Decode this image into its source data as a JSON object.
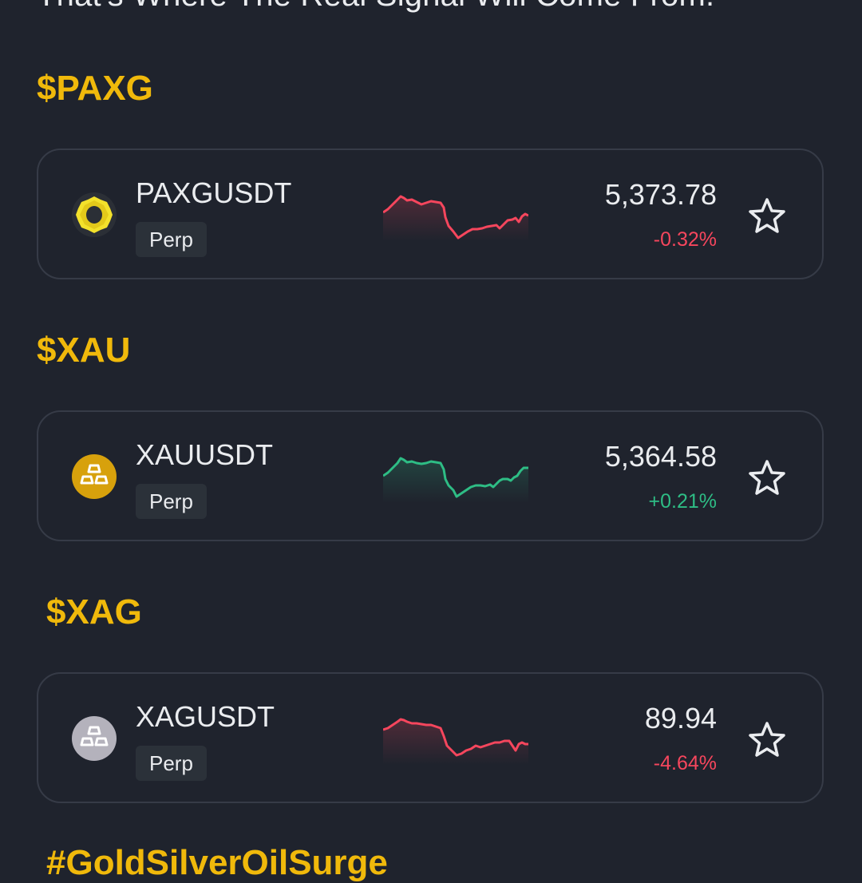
{
  "header": {
    "text": "That's Where The Real Signal Will Come From."
  },
  "sections": [
    {
      "title": "$PAXG",
      "card": {
        "icon": "paxg-coin-icon",
        "symbol": "PAXGUSDT",
        "badge": "Perp",
        "price": "5,373.78",
        "change": "-0.32%",
        "direction": "down",
        "sparkline_color": "#f6465d"
      }
    },
    {
      "title": "$XAU",
      "card": {
        "icon": "gold-bars-icon",
        "symbol": "XAUUSDT",
        "badge": "Perp",
        "price": "5,364.58",
        "change": "+0.21%",
        "direction": "up",
        "sparkline_color": "#2ebd85"
      }
    },
    {
      "title": "$XAG",
      "card": {
        "icon": "silver-bars-icon",
        "symbol": "XAGUSDT",
        "badge": "Perp",
        "price": "89.94",
        "change": "-4.64%",
        "direction": "down",
        "sparkline_color": "#f6465d"
      }
    }
  ],
  "footer": {
    "text": "#GoldSilverOilSurge"
  },
  "colors": {
    "background": "#1f232d",
    "accent": "#f0b90b",
    "up": "#2ebd85",
    "down": "#f6465d"
  }
}
